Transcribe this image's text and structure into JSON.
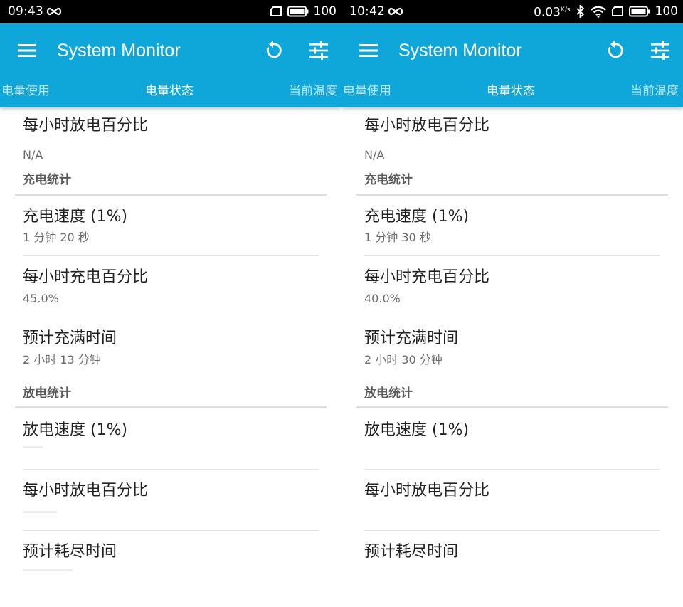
{
  "app": {
    "title": "System Monitor",
    "tabs": [
      "电量使用",
      "电量状态",
      "当前温度"
    ]
  },
  "left": {
    "status": {
      "time": "09:43",
      "battery": "100"
    },
    "rows": {
      "hourly_discharge_top": {
        "label": "每小时放电百分比",
        "value": "N/A"
      },
      "charge_section": "充电统计",
      "charge_speed": {
        "label": "充电速度 (1%)",
        "value": "1 分钟 20 秒"
      },
      "hourly_charge": {
        "label": "每小时充电百分比",
        "value": "45.0%"
      },
      "full_time": {
        "label": "预计充满时间",
        "value": "2 小时 13 分钟"
      },
      "discharge_section": "放电统计",
      "discharge_speed": {
        "label": "放电速度 (1%)"
      },
      "hourly_discharge": {
        "label": "每小时放电百分比"
      },
      "empty_time": {
        "label": "预计耗尽时间"
      }
    }
  },
  "right": {
    "status": {
      "time": "10:42",
      "speed": "0.03",
      "speed_unit": "K/s",
      "battery": "100"
    },
    "rows": {
      "hourly_discharge_top": {
        "label": "每小时放电百分比",
        "value": "N/A"
      },
      "charge_section": "充电统计",
      "charge_speed": {
        "label": "充电速度 (1%)",
        "value": "1 分钟 30 秒"
      },
      "hourly_charge": {
        "label": "每小时充电百分比",
        "value": "40.0%"
      },
      "full_time": {
        "label": "预计充满时间",
        "value": "2 小时 30 分钟"
      },
      "discharge_section": "放电统计",
      "discharge_speed": {
        "label": "放电速度 (1%)"
      },
      "hourly_discharge": {
        "label": "每小时放电百分比"
      },
      "empty_time": {
        "label": "预计耗尽时间"
      }
    }
  },
  "icons": [
    "menu-icon",
    "refresh-icon",
    "tune-icon",
    "infinity-icon",
    "sim-icon",
    "battery-icon",
    "bluetooth-icon",
    "wifi-icon"
  ],
  "colors": {
    "appbar": "#0fa6d9",
    "statusbar": "#000000",
    "text": "#222222",
    "subtext": "#6b6b6b"
  }
}
